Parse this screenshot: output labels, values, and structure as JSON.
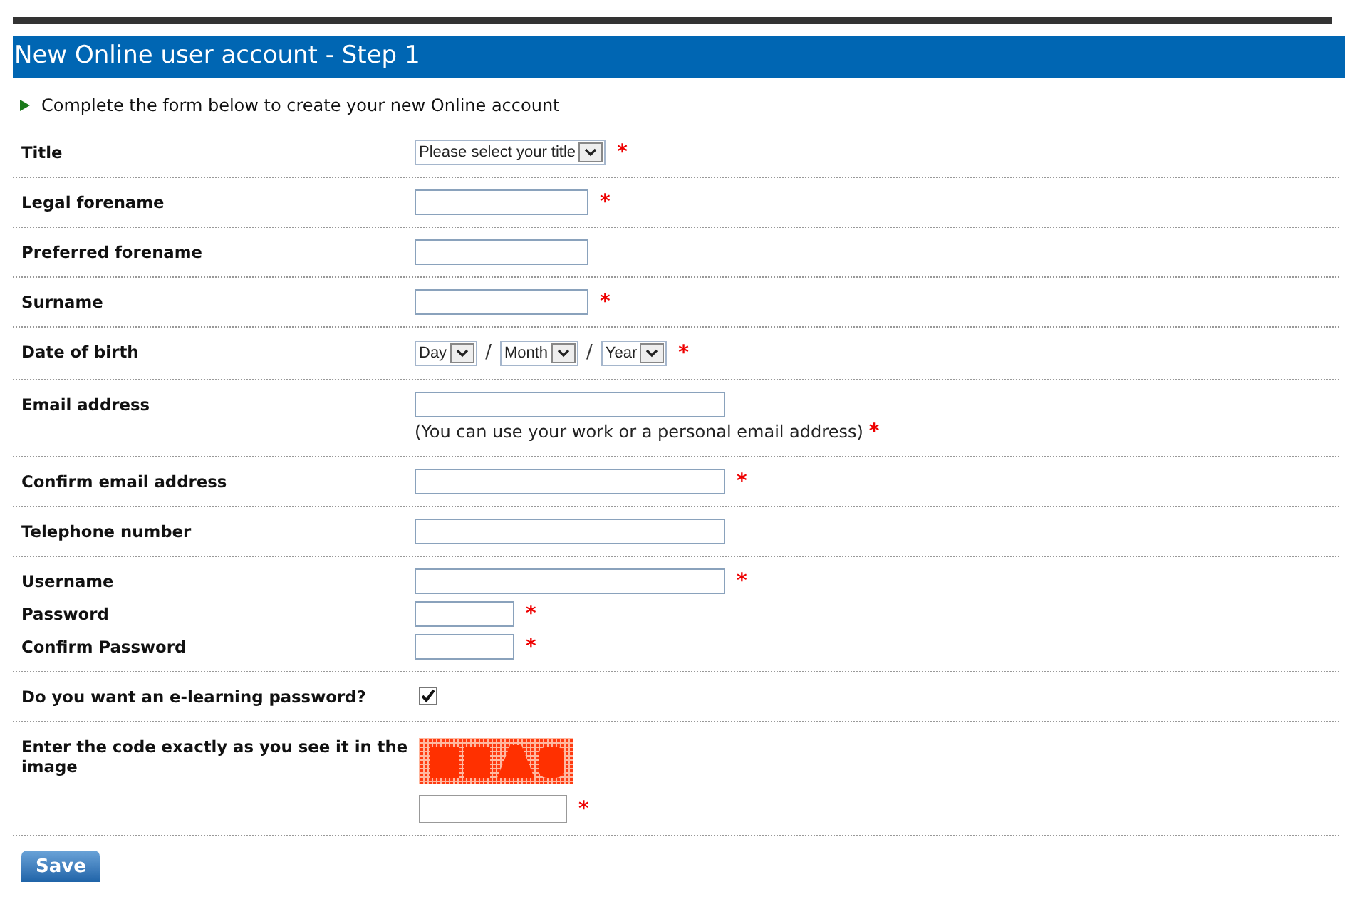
{
  "header": {
    "title": "New Online user account - Step 1"
  },
  "intro": "Complete the form below to create your new Online account",
  "sections": [
    {
      "fields": [
        {
          "kind": "select",
          "label": "Title",
          "value": "Please select your title",
          "required": "*"
        }
      ]
    },
    {
      "fields": [
        {
          "kind": "text",
          "label": "Legal forename",
          "required": "*"
        }
      ]
    },
    {
      "fields": [
        {
          "kind": "text",
          "label": "Preferred forename"
        }
      ]
    },
    {
      "fields": [
        {
          "kind": "text",
          "label": "Surname",
          "required": "*"
        }
      ]
    },
    {
      "fields": [
        {
          "kind": "date",
          "label": "Date of birth",
          "parts": [
            {
              "kind": "select",
              "value": "Day"
            },
            {
              "kind": "separator",
              "text": "/"
            },
            {
              "kind": "select",
              "value": "Month"
            },
            {
              "kind": "separator",
              "text": "/"
            },
            {
              "kind": "select",
              "value": "Year"
            }
          ],
          "required": "*"
        }
      ]
    },
    {
      "fields": [
        {
          "kind": "long_text",
          "label": "Email address",
          "hint": "(You can use your work or a personal email address)",
          "required": "*"
        }
      ]
    },
    {
      "fields": [
        {
          "kind": "long_text",
          "label": "Confirm email address",
          "required": "*"
        }
      ]
    },
    {
      "fields": [
        {
          "kind": "long_text",
          "label": "Telephone number"
        }
      ]
    },
    {
      "fields": [
        {
          "kind": "long_text",
          "label": "Username",
          "required": "*"
        },
        {
          "kind": "password",
          "label": "Password",
          "required": "*"
        },
        {
          "kind": "password",
          "label": "Confirm Password",
          "required": "*"
        }
      ]
    },
    {
      "fields": [
        {
          "kind": "checkbox",
          "label": "Do you want an e-learning password?",
          "checked": true
        }
      ]
    },
    {
      "fields": [
        {
          "kind": "captcha",
          "label": "Enter the code exactly as you see it in the image",
          "required": "*"
        }
      ]
    }
  ],
  "save_button": "Save"
}
